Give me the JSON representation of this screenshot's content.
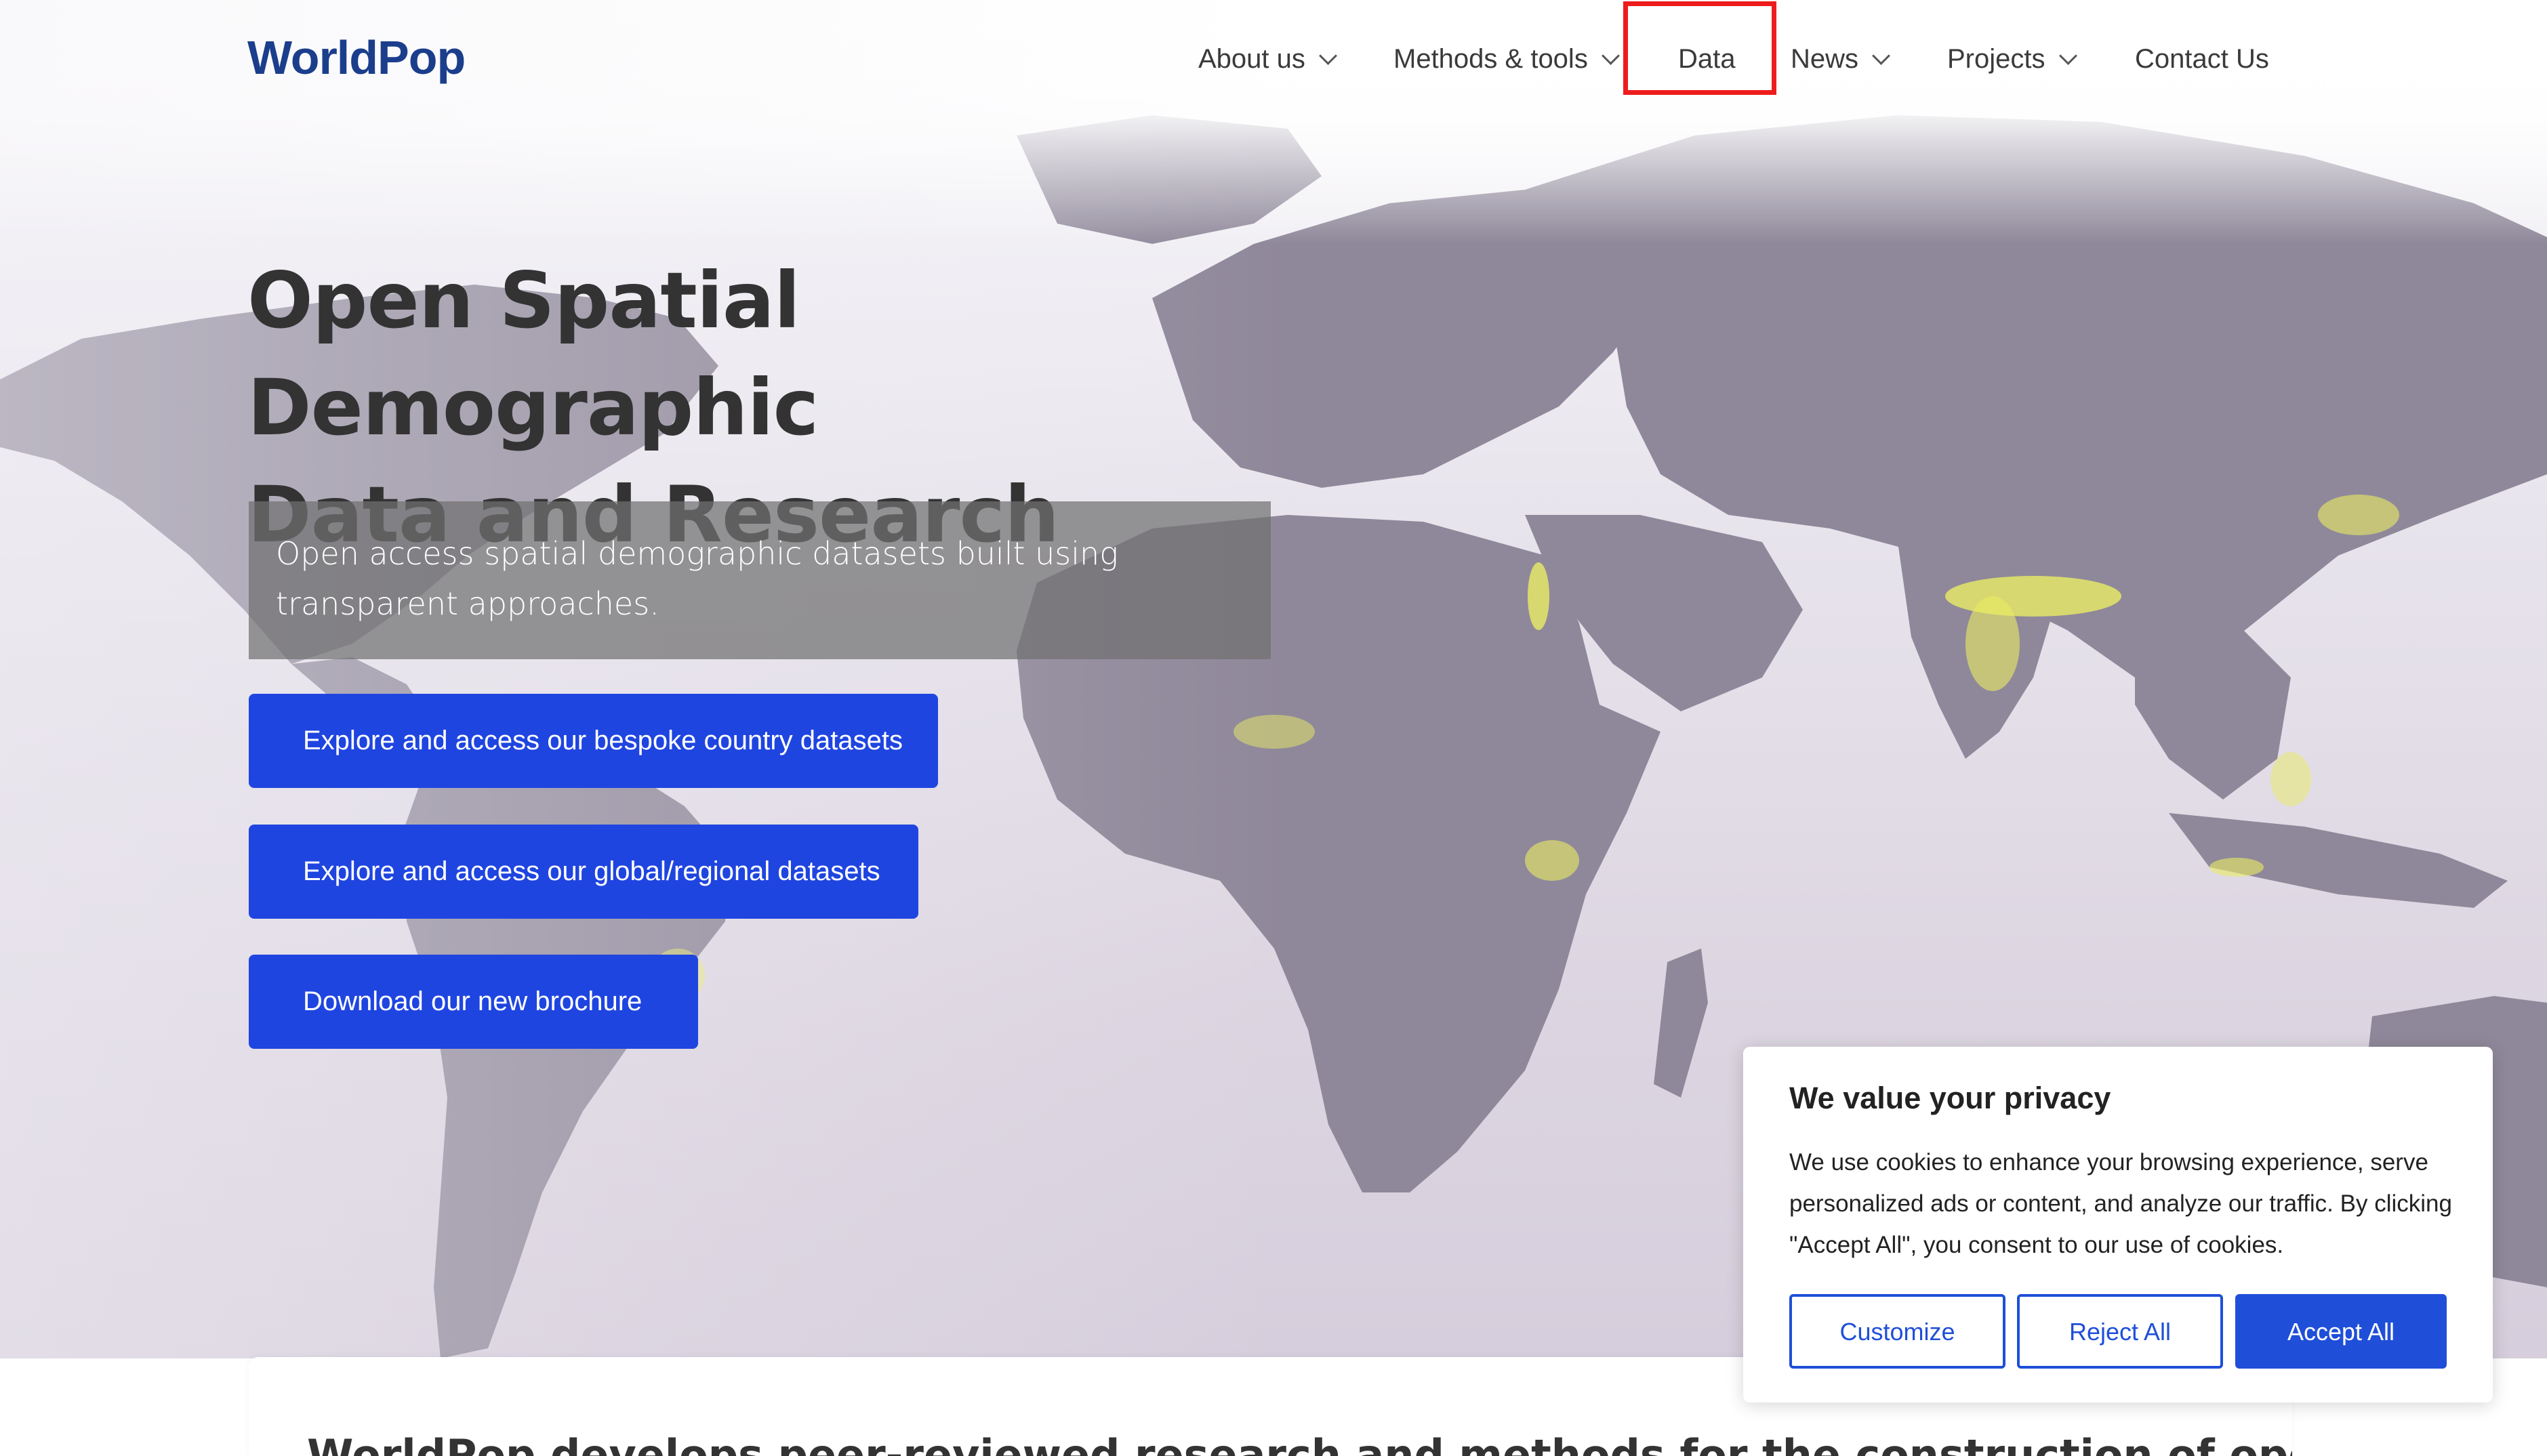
{
  "brand": {
    "logo_text": "WorldPop",
    "accent": "#1f45e0",
    "logo_color": "#1b3e8c"
  },
  "nav": {
    "items": [
      {
        "label": "About us",
        "has_dropdown": true
      },
      {
        "label": "Methods & tools",
        "has_dropdown": true
      },
      {
        "label": "Data",
        "has_dropdown": false,
        "highlighted": true
      },
      {
        "label": "News",
        "has_dropdown": true
      },
      {
        "label": "Projects",
        "has_dropdown": true
      },
      {
        "label": "Contact Us",
        "has_dropdown": false
      }
    ]
  },
  "hero": {
    "title_line1": "Open Spatial Demographic",
    "title_line2": "Data and Research",
    "subtitle": "Open access spatial demographic datasets built using transparent approaches.",
    "cta": [
      "Explore and access our bespoke country datasets",
      "Explore and access our global/regional datasets",
      "Download our new brochure"
    ]
  },
  "intro": {
    "text": "WorldPop develops peer-reviewed research and methods for the construction of open and high-resolution"
  },
  "cookie": {
    "title": "We value your privacy",
    "text": "We use cookies to enhance your browsing experience, serve personalized ads or content, and analyze our traffic. By clicking \"Accept All\", you consent to our use of cookies.",
    "buttons": {
      "customize": "Customize",
      "reject": "Reject All",
      "accept": "Accept All"
    }
  },
  "colors": {
    "highlight_border": "#ee1c1c",
    "map_land": "#8f889a",
    "map_lights": "#e9ec64"
  }
}
